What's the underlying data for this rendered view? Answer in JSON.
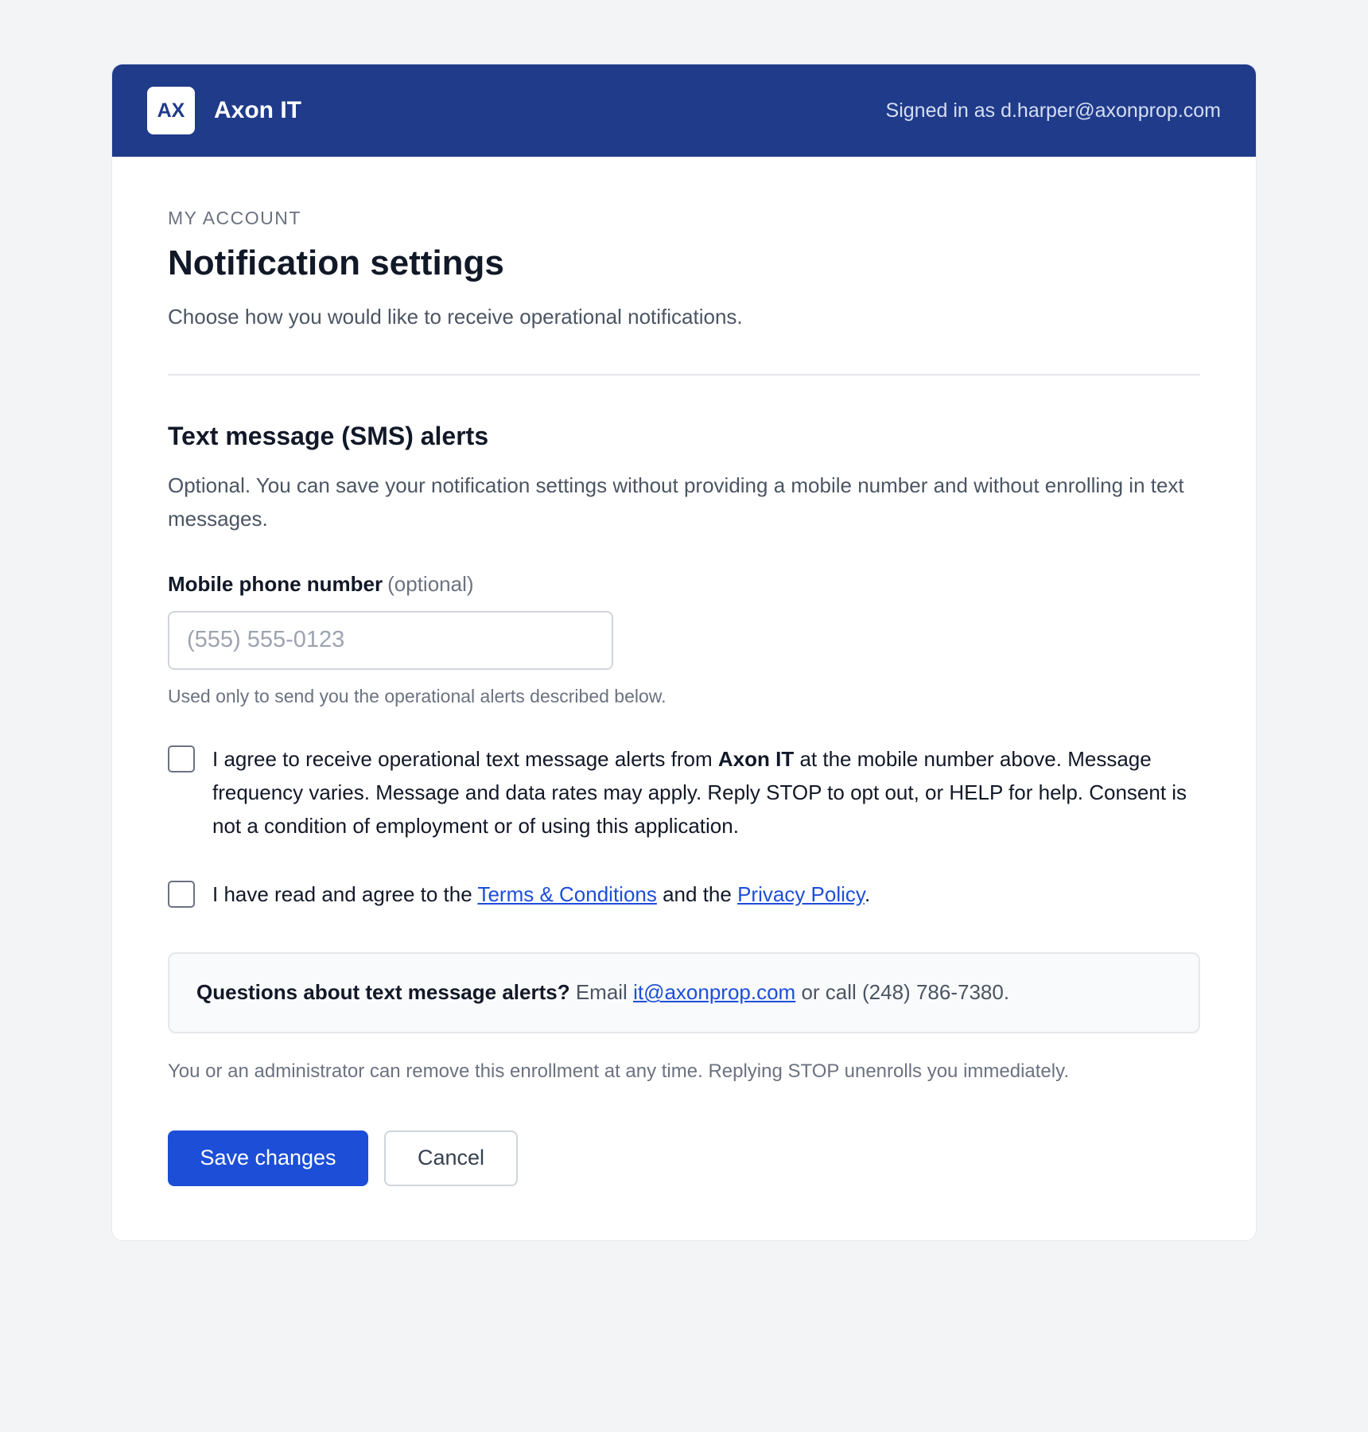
{
  "header": {
    "logo_text": "AX",
    "brand": "Axon IT",
    "signed_in": "Signed in as d.harper@axonprop.com",
    "color": "#1f3b8a"
  },
  "page": {
    "eyebrow": "MY ACCOUNT",
    "title": "Notification settings",
    "subtitle": "Choose how you would like to receive operational notifications."
  },
  "sms": {
    "title": "Text message (SMS) alerts",
    "description": "Optional. You can save your notification settings without providing a mobile number and without enrolling in text messages.",
    "phone_label": "Mobile phone number",
    "phone_optional": "(optional)",
    "phone_placeholder": "(555) 555-0123",
    "phone_value": "",
    "phone_help": "Used only to send you the operational alerts described below.",
    "consent": {
      "checked": false,
      "text_before": "I agree to receive operational text message alerts from ",
      "brand": "Axon IT",
      "text_after": " at the mobile number above. Message frequency varies. Message and data rates may apply. Reply STOP to opt out, or HELP for help. Consent is not a condition of employment or of using this application."
    },
    "terms": {
      "checked": false,
      "text_before": "I have read and agree to the ",
      "terms_link": "Terms & Conditions",
      "text_middle": " and the ",
      "privacy_link": "Privacy Policy",
      "text_after": "."
    },
    "info": {
      "question": "Questions about text message alerts?",
      "email_prefix": " Email ",
      "email": "it@axonprop.com",
      "phone_text": " or call (248) 786-7380."
    },
    "footnote": "You or an administrator can remove this enrollment at any time. Replying STOP unenrolls you immediately."
  },
  "actions": {
    "save": "Save changes",
    "cancel": "Cancel",
    "primary_color": "#1d4ed8"
  }
}
